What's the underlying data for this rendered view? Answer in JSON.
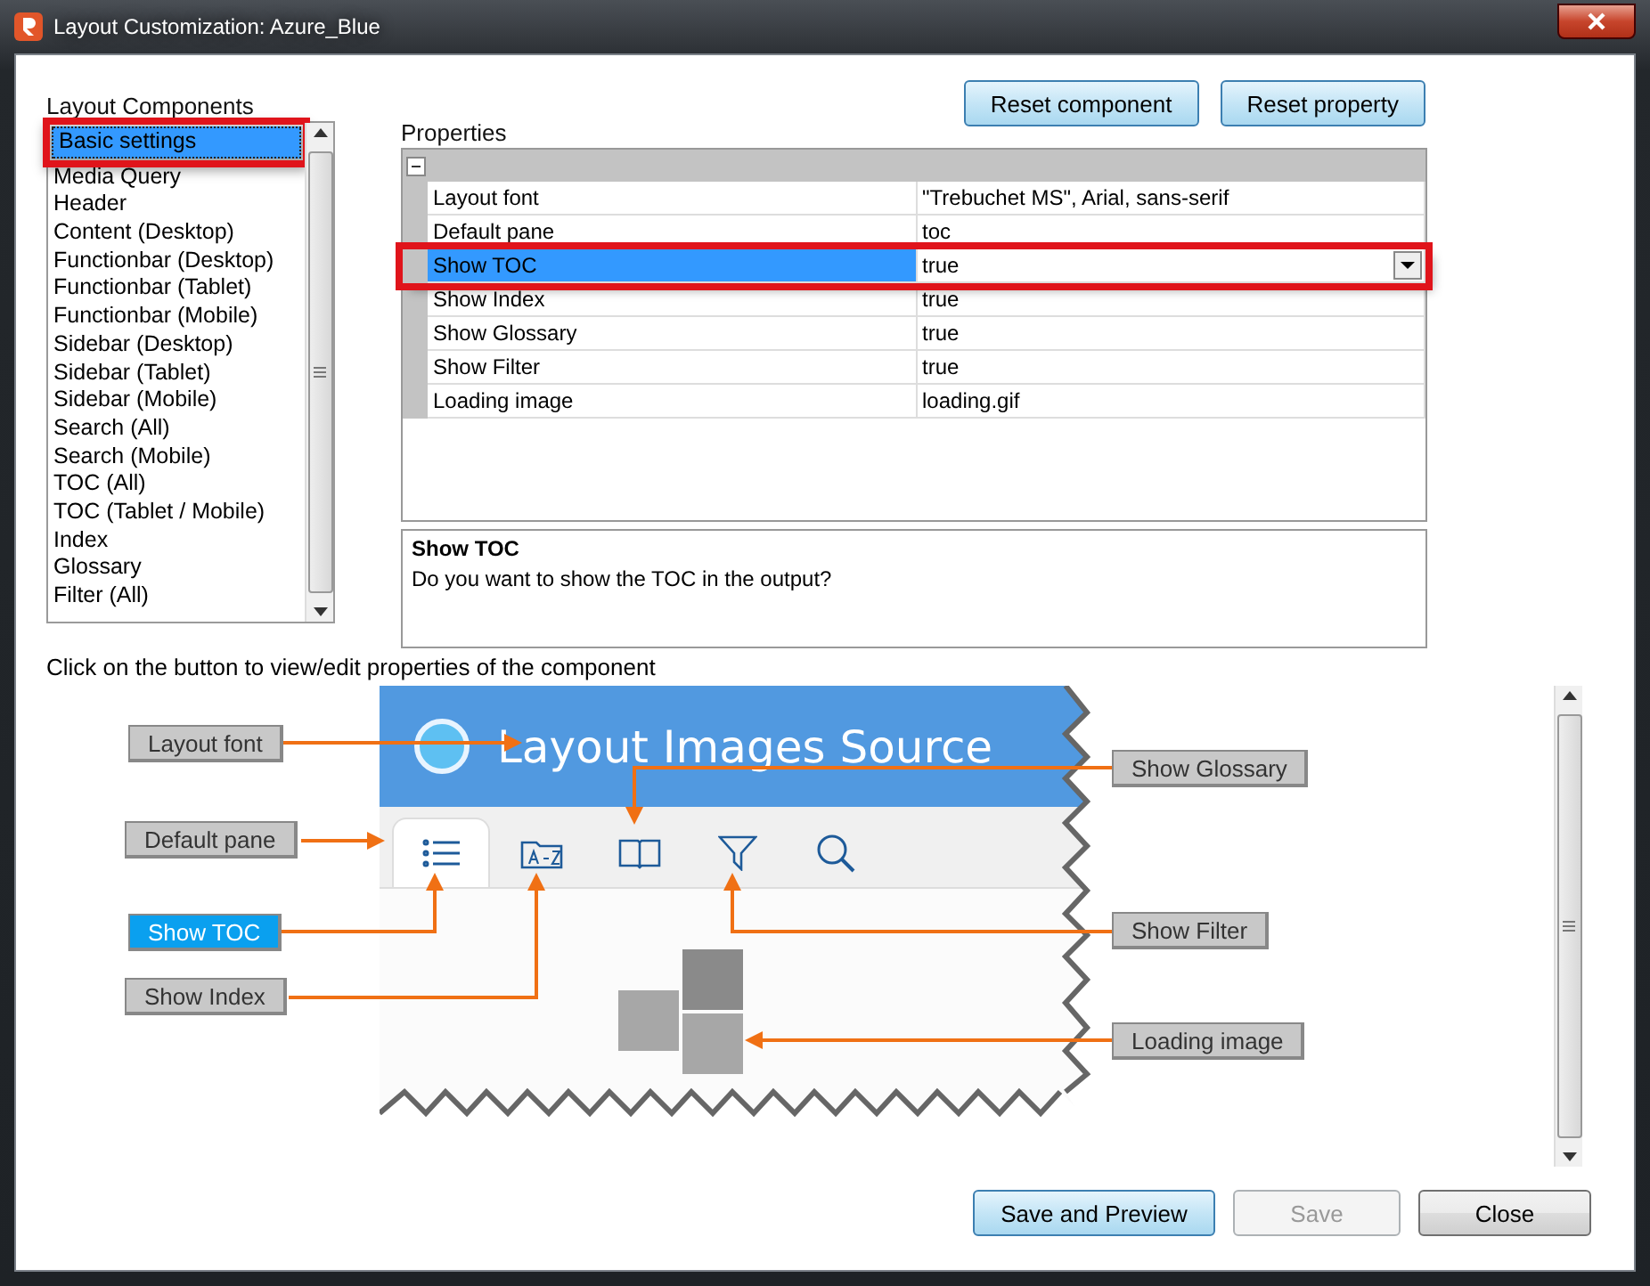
{
  "window": {
    "title": "Layout Customization: Azure_Blue"
  },
  "top_buttons": [
    "Reset component",
    "Reset property"
  ],
  "components": {
    "label": "Layout Components",
    "items": [
      {
        "label": "Basic settings",
        "selected": true,
        "highlighted": true
      },
      {
        "label": "Media Query",
        "selected": false,
        "highlighted": false
      },
      {
        "label": "Header",
        "selected": false,
        "highlighted": false
      },
      {
        "label": "Content (Desktop)",
        "selected": false,
        "highlighted": false
      },
      {
        "label": "Functionbar (Desktop)",
        "selected": false,
        "highlighted": false
      },
      {
        "label": "Functionbar (Tablet)",
        "selected": false,
        "highlighted": false
      },
      {
        "label": "Functionbar (Mobile)",
        "selected": false,
        "highlighted": false
      },
      {
        "label": "Sidebar (Desktop)",
        "selected": false,
        "highlighted": false
      },
      {
        "label": "Sidebar (Tablet)",
        "selected": false,
        "highlighted": false
      },
      {
        "label": "Sidebar (Mobile)",
        "selected": false,
        "highlighted": false
      },
      {
        "label": "Search (All)",
        "selected": false,
        "highlighted": false
      },
      {
        "label": "Search (Mobile)",
        "selected": false,
        "highlighted": false
      },
      {
        "label": "TOC (All)",
        "selected": false,
        "highlighted": false
      },
      {
        "label": "TOC (Tablet / Mobile)",
        "selected": false,
        "highlighted": false
      },
      {
        "label": "Index",
        "selected": false,
        "highlighted": false
      },
      {
        "label": "Glossary",
        "selected": false,
        "highlighted": false
      },
      {
        "label": "Filter (All)",
        "selected": false,
        "highlighted": false
      }
    ]
  },
  "properties": {
    "label": "Properties",
    "rows": [
      {
        "name": "Layout font",
        "value": "\"Trebuchet MS\", Arial, sans-serif",
        "selected": false,
        "highlighted": false
      },
      {
        "name": "Default pane",
        "value": "toc",
        "selected": false,
        "highlighted": false
      },
      {
        "name": "Show TOC",
        "value": "true",
        "selected": true,
        "highlighted": true
      },
      {
        "name": "Show Index",
        "value": "true",
        "selected": false,
        "highlighted": false
      },
      {
        "name": "Show Glossary",
        "value": "true",
        "selected": false,
        "highlighted": false
      },
      {
        "name": "Show Filter",
        "value": "true",
        "selected": false,
        "highlighted": false
      },
      {
        "name": "Loading image",
        "value": "loading.gif",
        "selected": false,
        "highlighted": false
      }
    ]
  },
  "description": {
    "title": "Show TOC",
    "text": "Do you want to show the TOC in the output?"
  },
  "preview": {
    "hint": "Click on the button to view/edit properties of the component",
    "title": "Layout Images Source",
    "callouts": [
      {
        "label": "Layout font",
        "selected": false
      },
      {
        "label": "Default pane",
        "selected": false
      },
      {
        "label": "Show TOC",
        "selected": true
      },
      {
        "label": "Show Index",
        "selected": false
      },
      {
        "label": "Show Glossary",
        "selected": false
      },
      {
        "label": "Show Filter",
        "selected": false
      },
      {
        "label": "Loading image",
        "selected": false
      }
    ]
  },
  "footer_buttons": [
    {
      "label": "Save and Preview",
      "kind": "default",
      "disabled": false
    },
    {
      "label": "Save",
      "kind": "normal",
      "disabled": true
    },
    {
      "label": "Close",
      "kind": "normal",
      "disabled": false
    }
  ]
}
